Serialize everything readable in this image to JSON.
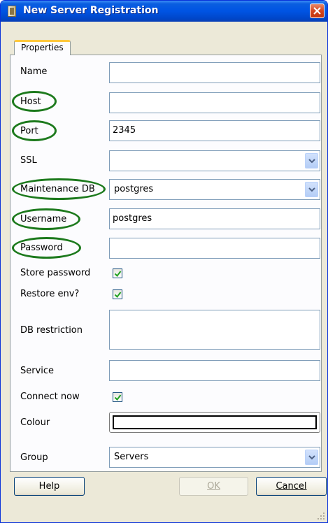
{
  "window": {
    "title": "New Server Registration"
  },
  "tabs": [
    {
      "label": "Properties"
    }
  ],
  "form": {
    "name": {
      "label": "Name",
      "value": ""
    },
    "host": {
      "label": "Host",
      "value": ""
    },
    "port": {
      "label": "Port",
      "value": "2345"
    },
    "ssl": {
      "label": "SSL",
      "value": ""
    },
    "maintenance_db": {
      "label": "Maintenance DB",
      "value": "postgres"
    },
    "username": {
      "label": "Username",
      "value": "postgres"
    },
    "password": {
      "label": "Password",
      "value": ""
    },
    "store_password": {
      "label": "Store password",
      "checked": true
    },
    "restore_env": {
      "label": "Restore env?",
      "checked": true
    },
    "db_restriction": {
      "label": "DB restriction",
      "value": ""
    },
    "service": {
      "label": "Service",
      "value": ""
    },
    "connect_now": {
      "label": "Connect now",
      "checked": true
    },
    "colour": {
      "label": "Colour",
      "value": ""
    },
    "group": {
      "label": "Group",
      "value": "Servers"
    }
  },
  "buttons": {
    "help": "Help",
    "ok": "OK",
    "cancel": "Cancel"
  },
  "colors": {
    "title_bar": "#0054e3",
    "highlight_ellipse": "#1d7a1d",
    "checkmark": "#21a121"
  }
}
